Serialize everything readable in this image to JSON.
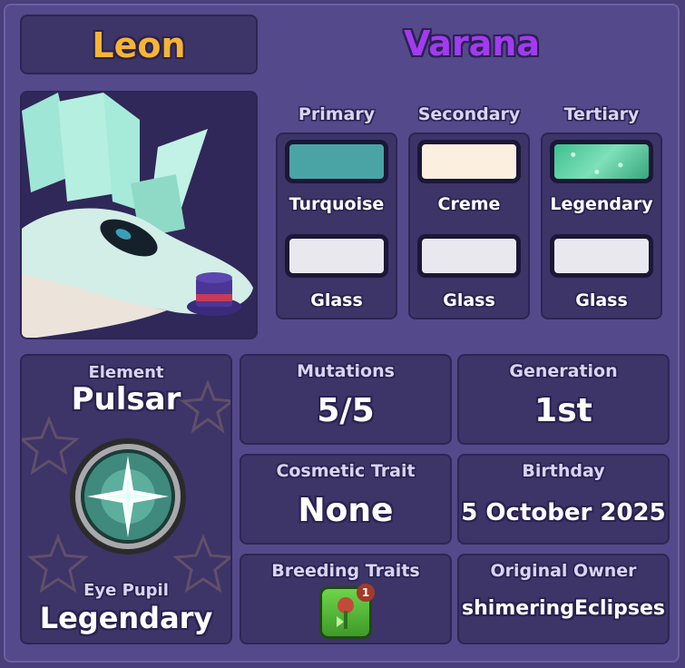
{
  "header": {
    "owner_name": "Leon",
    "dragon_name": "Varana"
  },
  "colors": {
    "columns": [
      {
        "title": "Primary",
        "top_label": "Turquoise",
        "top_color": "#4aa4a6",
        "bottom_label": "Glass",
        "bottom_color": "#e8e8ee"
      },
      {
        "title": "Secondary",
        "top_label": "Creme",
        "top_color": "#fbefe0",
        "bottom_label": "Glass",
        "bottom_color": "#e8e8ee"
      },
      {
        "title": "Tertiary",
        "top_label": "Legendary",
        "top_color": "#5ccf9f",
        "bottom_label": "Glass",
        "bottom_color": "#e8e8ee"
      }
    ]
  },
  "element": {
    "label": "Element",
    "value": "Pulsar",
    "eye_label": "Eye Pupil",
    "eye_value": "Legendary"
  },
  "stats": {
    "mutations": {
      "label": "Mutations",
      "value": "5/5"
    },
    "generation": {
      "label": "Generation",
      "value": "1st"
    },
    "cosmetic": {
      "label": "Cosmetic Trait",
      "value": "None"
    },
    "birthday": {
      "label": "Birthday",
      "value": "5 October 2025"
    },
    "breeding": {
      "label": "Breeding Traits",
      "badge_count": "1"
    },
    "owner": {
      "label": "Original Owner",
      "value": "shimeringEclipses"
    }
  },
  "theme": {
    "owner_name_color": "#f6b534",
    "dragon_name_color": "#a23af0",
    "panel_bg": "#3d3468"
  }
}
